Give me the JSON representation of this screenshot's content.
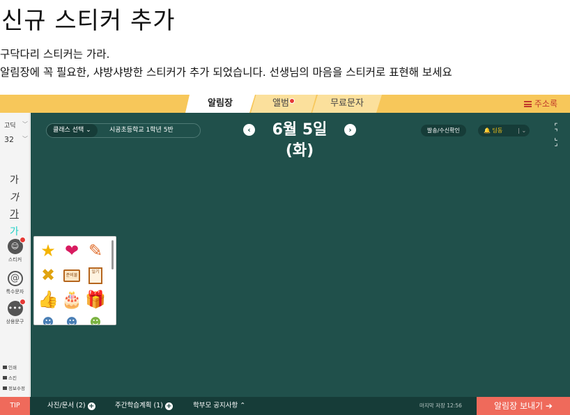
{
  "header": {
    "title": "신규 스티커 추가",
    "desc_line1": "구닥다리 스티커는 가라.",
    "desc_line2": "알림장에 꼭 필요한, 샤방샤방한 스티커가 추가 되었습니다. 선생님의 마음을 스티커로 표현해 보세요"
  },
  "topbar": {
    "tabs": [
      {
        "label": "알림장"
      },
      {
        "label": "앨범"
      },
      {
        "label": "무료문자"
      }
    ],
    "address_book": "주소록"
  },
  "leftpanel": {
    "font_family": "고딕",
    "font_size": "32",
    "style_regular": "가",
    "style_italic": "가",
    "style_underline": "가",
    "style_color": "가",
    "sticker_label": "스티커",
    "special_char_label": "특수문자",
    "common_phrase_label": "상용문구",
    "print_label": "인쇄",
    "scan_label": "스킨",
    "info_label": "정보수정"
  },
  "board": {
    "class_select": "클래스 선택",
    "class_name": "시공초등학교 1학년 5반",
    "date": "6월 5일 (화)",
    "send_confirm": "발송/수신확인",
    "bell_label": "딩동"
  },
  "stickers": [
    {
      "icon": "star-sticker",
      "glyph": "⭐"
    },
    {
      "icon": "heart-sticker",
      "glyph": "❤"
    },
    {
      "icon": "pencil-sticker",
      "glyph": "✏"
    },
    {
      "icon": "cross-sticker",
      "glyph": "✖"
    },
    {
      "icon": "prep-sticker",
      "text": "준비물"
    },
    {
      "icon": "diary-sticker",
      "text": "일기"
    },
    {
      "icon": "thumbs-up-sticker",
      "glyph": "👍"
    },
    {
      "icon": "cake-sticker",
      "glyph": "🎂"
    },
    {
      "icon": "gift-sticker",
      "glyph": "🎁"
    }
  ],
  "bottombar": {
    "tip": "TIP",
    "photo_doc": "사진/문서 (2)",
    "weekly_plan": "주간학습계획 (1)",
    "parent_notice": "학부모 공지사항",
    "last_saved": "마지막 저장 12:56",
    "send": "알림장 보내기"
  },
  "colors": {
    "accent_yellow": "#f7c75a",
    "board_green": "#20504b",
    "send_red": "#ef6a5b"
  }
}
